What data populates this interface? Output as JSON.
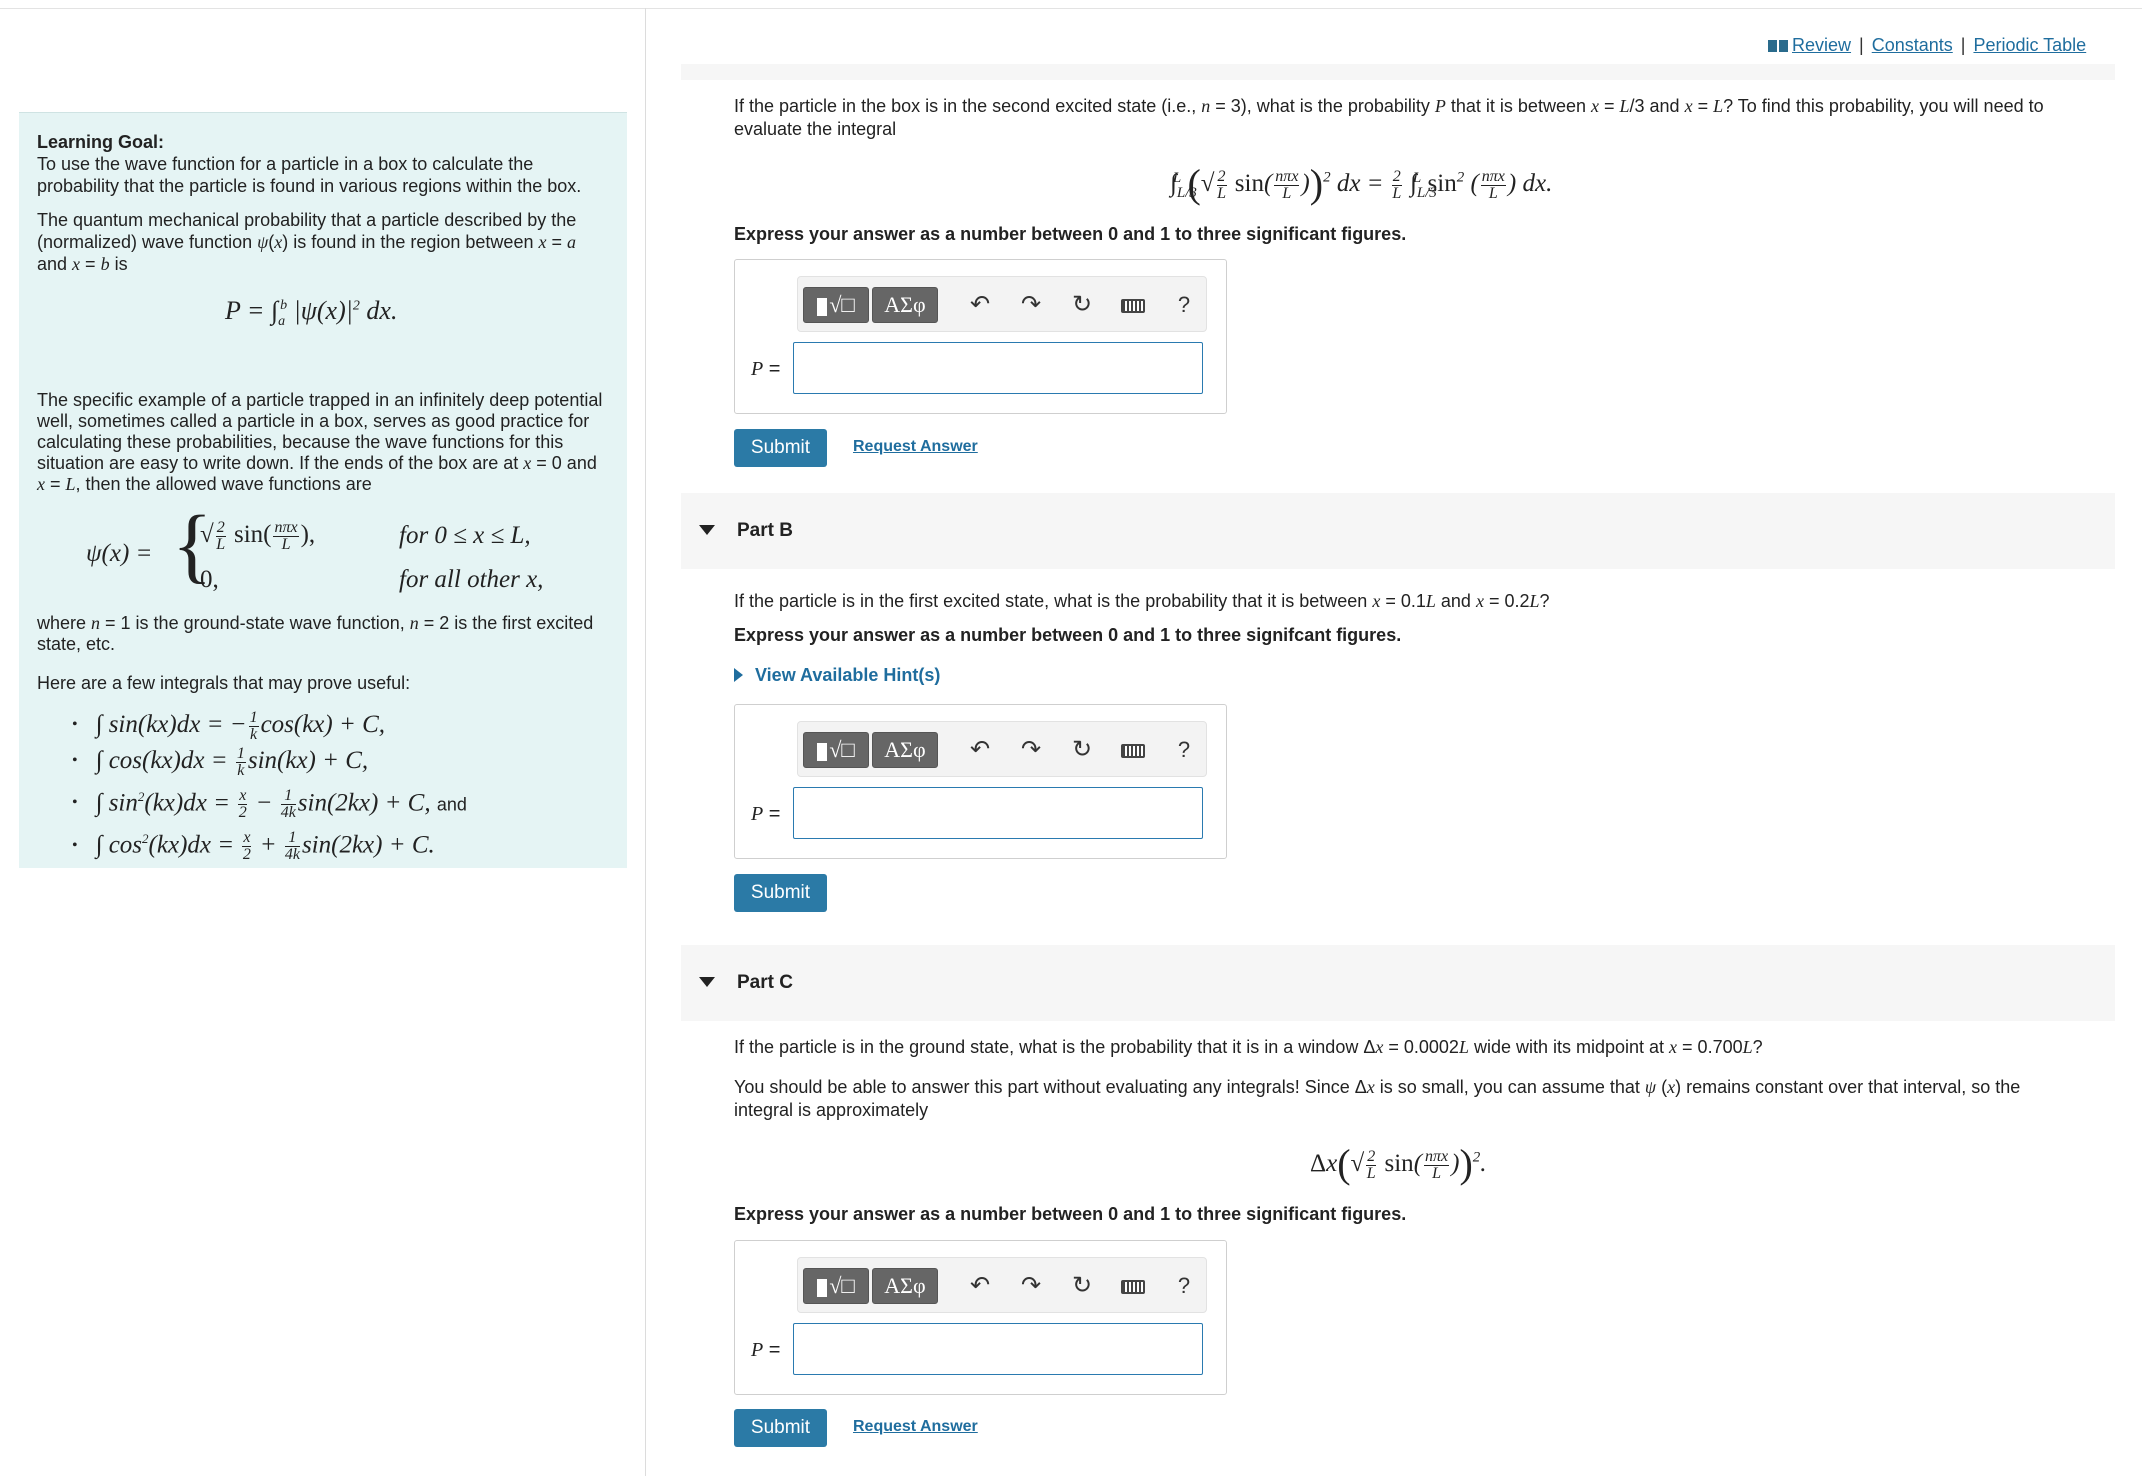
{
  "links": {
    "review": "Review",
    "constants": "Constants",
    "periodic_table": "Periodic Table",
    "sep": "|"
  },
  "goal": {
    "title": "Learning Goal:",
    "intro": "To use the wave function for a particle in a box to calculate the probability that the particle is found in various regions within the box.",
    "para1": "The quantum mechanical probability that a particle described by the (normalized) wave function ψ(x) is found in the region between x = a and x = b is",
    "prob_formula": "P = ∫ₐᵇ |ψ(x)|² dx.",
    "para2": "The specific example of a particle trapped in an infinitely deep potential well, sometimes called a particle in a box, serves as good practice for calculating these probabilities, because the wave functions for this situation are easy to write down. If the ends of the box are at x = 0 and x = L, then the allowed wave functions are",
    "psi_lhs": "ψ(x) =",
    "psi_case1_cond": "for 0 ≤ x ≤ L,",
    "psi_case2_val": "0,",
    "psi_case2_cond": "for all other x,",
    "para3": "where n = 1 is the ground-state wave function, n = 2 is the first excited state, etc.",
    "para4": "Here are a few integrals that may prove useful:",
    "integral_and": "and"
  },
  "partA": {
    "question": "If the particle in the box is in the second excited state (i.e., n = 3), what is the probability P that it is between x = L/3 and x = L? To find this probability, you will need to evaluate the integral",
    "instruction": "Express your answer as a number between 0 and 1 to three significant figures.",
    "input_label": "P =",
    "input_value": "",
    "submit": "Submit",
    "request": "Request Answer"
  },
  "partB": {
    "label": "Part B",
    "question": "If the particle is in the first excited state, what is the probability that it is between x = 0.1L and x = 0.2L?",
    "instruction": "Express your answer as a number between 0 and 1 to three signifcant figures.",
    "hint": "View Available Hint(s)",
    "input_label": "P =",
    "input_value": "",
    "submit": "Submit"
  },
  "partC": {
    "label": "Part C",
    "question": "If the particle is in the ground state, what is the probability that it is in a window Δx = 0.0002L wide with its midpoint at x = 0.700L?",
    "question2": "You should be able to answer this part without evaluating any integrals! Since Δx is so small, you can assume that ψ (x) remains constant over that interval, so the integral is approximately",
    "instruction": "Express your answer as a number between 0 and 1 to three significant figures.",
    "input_label": "P =",
    "input_value": "",
    "submit": "Submit",
    "request": "Request Answer"
  },
  "toolbar": {
    "templates": "√□",
    "symbols": "ΑΣφ",
    "undo": "↶",
    "redo": "↷",
    "reset": "↻",
    "help": "?"
  },
  "colors": {
    "accent": "#2b7aa6",
    "link": "#1f6d9e",
    "goal_bg": "#e5f4f4"
  }
}
